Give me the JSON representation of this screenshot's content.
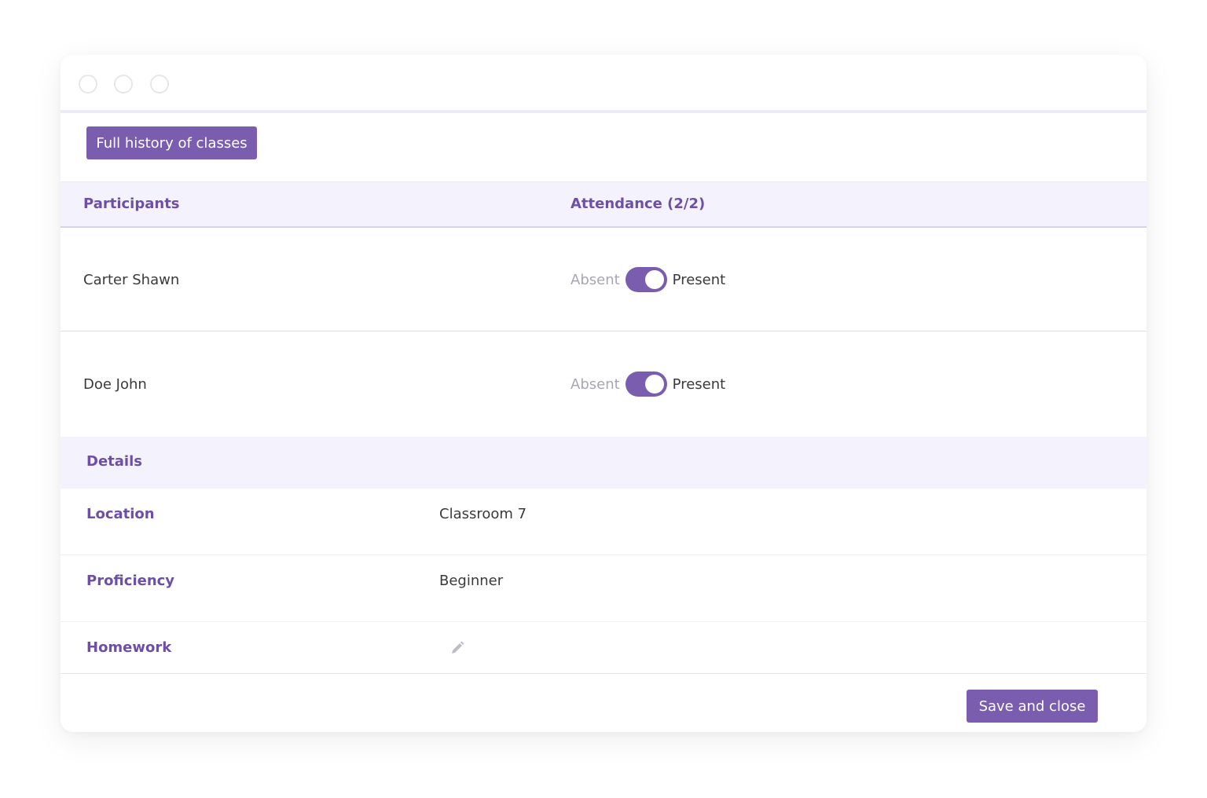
{
  "toolbar": {
    "history_label": "Full history of classes",
    "save_label": "Save and close"
  },
  "participants_table": {
    "col_participants": "Participants",
    "col_attendance": "Attendance (2/2)",
    "rows": [
      {
        "name": "Carter Shawn",
        "absent_label": "Absent",
        "present_label": "Present",
        "present": true
      },
      {
        "name": "Doe John",
        "absent_label": "Absent",
        "present_label": "Present",
        "present": true
      }
    ]
  },
  "details": {
    "title": "Details",
    "location": {
      "label": "Location",
      "value": "Classroom 7"
    },
    "proficiency": {
      "label": "Proficiency",
      "value": "Beginner"
    },
    "homework": {
      "label": "Homework",
      "icon": "pencil-icon"
    }
  },
  "colors": {
    "accent": "#7a5daf",
    "header_text": "#6d4fa8",
    "header_bg": "#f4f2fc",
    "muted_text": "#a7a7b4"
  }
}
